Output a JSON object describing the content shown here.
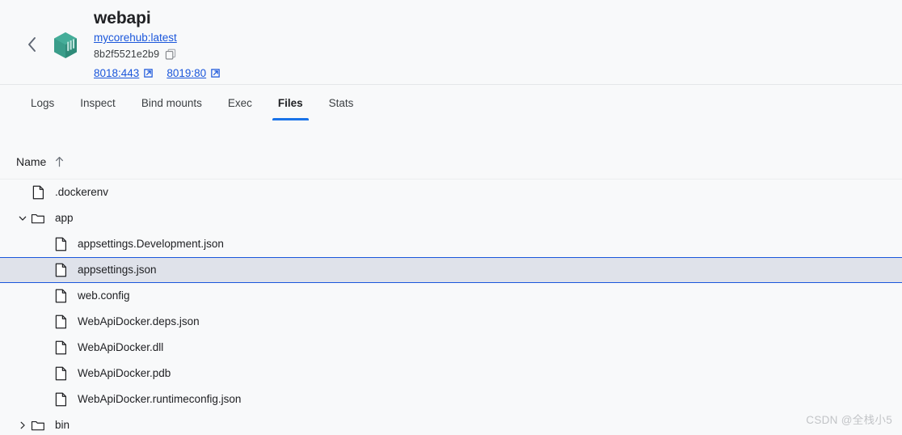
{
  "header": {
    "back_icon": "chevron-left-icon",
    "container_icon": "docker-container-cube-icon",
    "title": "webapi",
    "image": "mycorehub:latest",
    "container_id": "8b2f5521e2b9",
    "copy_icon": "copy-icon",
    "ports": [
      {
        "label": "8018:443",
        "icon": "external-link-icon"
      },
      {
        "label": "8019:80",
        "icon": "external-link-icon"
      }
    ]
  },
  "tabs": [
    {
      "label": "Logs",
      "active": false
    },
    {
      "label": "Inspect",
      "active": false
    },
    {
      "label": "Bind mounts",
      "active": false
    },
    {
      "label": "Exec",
      "active": false
    },
    {
      "label": "Files",
      "active": true
    },
    {
      "label": "Stats",
      "active": false
    }
  ],
  "files": {
    "column_header": "Name",
    "sort_icon": "arrow-up-icon",
    "sort_direction": "ascending",
    "rows": [
      {
        "name": ".dockerenv",
        "type": "file",
        "depth": 0,
        "expanded": null,
        "selected": false
      },
      {
        "name": "app",
        "type": "folder",
        "depth": 0,
        "expanded": true,
        "selected": false
      },
      {
        "name": "appsettings.Development.json",
        "type": "file",
        "depth": 1,
        "expanded": null,
        "selected": false
      },
      {
        "name": "appsettings.json",
        "type": "file",
        "depth": 1,
        "expanded": null,
        "selected": true
      },
      {
        "name": "web.config",
        "type": "file",
        "depth": 1,
        "expanded": null,
        "selected": false
      },
      {
        "name": "WebApiDocker.deps.json",
        "type": "file",
        "depth": 1,
        "expanded": null,
        "selected": false
      },
      {
        "name": "WebApiDocker.dll",
        "type": "file",
        "depth": 1,
        "expanded": null,
        "selected": false
      },
      {
        "name": "WebApiDocker.pdb",
        "type": "file",
        "depth": 1,
        "expanded": null,
        "selected": false
      },
      {
        "name": "WebApiDocker.runtimeconfig.json",
        "type": "file",
        "depth": 1,
        "expanded": null,
        "selected": false
      },
      {
        "name": "bin",
        "type": "folder",
        "depth": 0,
        "expanded": false,
        "selected": false
      }
    ]
  },
  "watermark": "CSDN @全栈小5",
  "colors": {
    "accent": "#1a73e8",
    "link": "#1a56db",
    "container_icon": "#3a9d8a",
    "selected_bg": "#dfe2ea",
    "page_bg": "#f8f9fa",
    "text": "#202124"
  }
}
